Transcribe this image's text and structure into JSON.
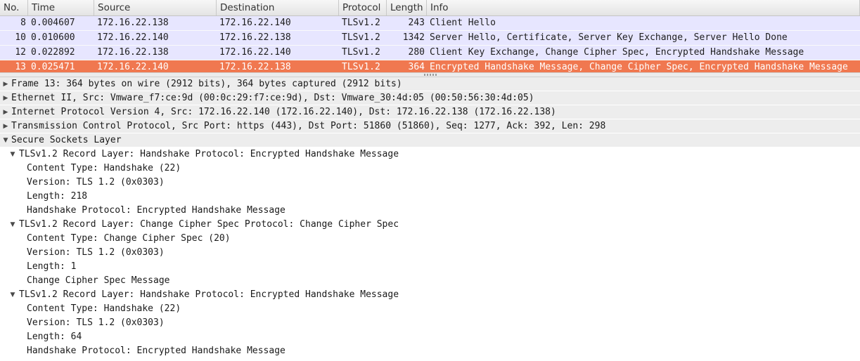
{
  "packet_list": {
    "columns": {
      "no": "No.",
      "time": "Time",
      "source": "Source",
      "destination": "Destination",
      "protocol": "Protocol",
      "length": "Length",
      "info": "Info"
    },
    "rows": [
      {
        "no": "8",
        "time": "0.004607",
        "source": "172.16.22.138",
        "destination": "172.16.22.140",
        "protocol": "TLSv1.2",
        "length": "243",
        "info": "Client Hello"
      },
      {
        "no": "10",
        "time": "0.010600",
        "source": "172.16.22.140",
        "destination": "172.16.22.138",
        "protocol": "TLSv1.2",
        "length": "1342",
        "info": "Server Hello, Certificate, Server Key Exchange, Server Hello Done"
      },
      {
        "no": "12",
        "time": "0.022892",
        "source": "172.16.22.138",
        "destination": "172.16.22.140",
        "protocol": "TLSv1.2",
        "length": "280",
        "info": "Client Key Exchange, Change Cipher Spec, Encrypted Handshake Message"
      },
      {
        "no": "13",
        "time": "0.025471",
        "source": "172.16.22.140",
        "destination": "172.16.22.138",
        "protocol": "TLSv1.2",
        "length": "364",
        "info": "Encrypted Handshake Message, Change Cipher Spec, Encrypted Handshake Message"
      }
    ],
    "selected_row_no": "13"
  },
  "colors": {
    "tls_row_bg": "#e7e6ff",
    "selected_row_bg": "#f07850",
    "tree_top_level_bg": "#ededed"
  },
  "details": {
    "expander_collapsed_icon": "triangle-right-icon",
    "expander_expanded_icon": "triangle-down-icon",
    "frame": "Frame 13: 364 bytes on wire (2912 bits), 364 bytes captured (2912 bits)",
    "ethernet": "Ethernet II, Src: Vmware_f7:ce:9d (00:0c:29:f7:ce:9d), Dst: Vmware_30:4d:05 (00:50:56:30:4d:05)",
    "ip": "Internet Protocol Version 4, Src: 172.16.22.140 (172.16.22.140), Dst: 172.16.22.138 (172.16.22.138)",
    "tcp": "Transmission Control Protocol, Src Port: https (443), Dst Port: 51860 (51860), Seq: 1277, Ack: 392, Len: 298",
    "ssl": "Secure Sockets Layer",
    "records": [
      {
        "title": "TLSv1.2 Record Layer: Handshake Protocol: Encrypted Handshake Message",
        "fields": [
          "Content Type: Handshake (22)",
          "Version: TLS 1.2 (0x0303)",
          "Length: 218",
          "Handshake Protocol: Encrypted Handshake Message"
        ]
      },
      {
        "title": "TLSv1.2 Record Layer: Change Cipher Spec Protocol: Change Cipher Spec",
        "fields": [
          "Content Type: Change Cipher Spec (20)",
          "Version: TLS 1.2 (0x0303)",
          "Length: 1",
          "Change Cipher Spec Message"
        ]
      },
      {
        "title": "TLSv1.2 Record Layer: Handshake Protocol: Encrypted Handshake Message",
        "fields": [
          "Content Type: Handshake (22)",
          "Version: TLS 1.2 (0x0303)",
          "Length: 64",
          "Handshake Protocol: Encrypted Handshake Message"
        ]
      }
    ]
  }
}
